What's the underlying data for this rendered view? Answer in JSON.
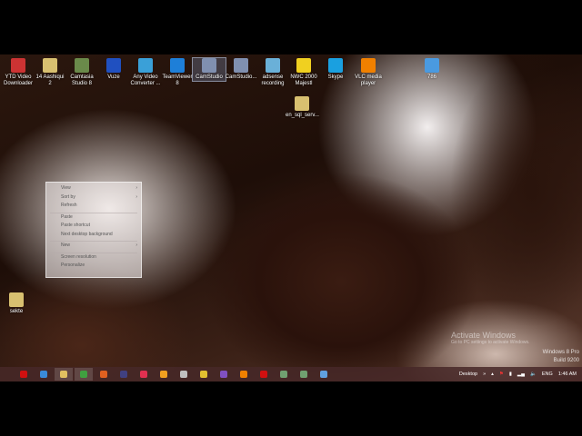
{
  "desktop_icons": [
    {
      "label": "YTD Video Downloader",
      "icon": "ytd-icon",
      "color": "#c33"
    },
    {
      "label": "14 Aashiqui 2",
      "icon": "folder-icon",
      "color": "#d8c070"
    },
    {
      "label": "Camtasia Studio 8",
      "icon": "camtasia-icon",
      "color": "#6a8a4a"
    },
    {
      "label": "Vuze",
      "icon": "vuze-icon",
      "color": "#2050c0"
    },
    {
      "label": "Any Video Converter ...",
      "icon": "converter-icon",
      "color": "#3aa0d8"
    },
    {
      "label": "TeamViewer 8",
      "icon": "teamviewer-icon",
      "color": "#1e7fd8"
    },
    {
      "label": "CamStudio",
      "icon": "camstudio-icon",
      "color": "#8090b0"
    },
    {
      "label": "CamStudio...",
      "icon": "camstudio-icon",
      "color": "#8090b0"
    },
    {
      "label": "adsense recording",
      "icon": "recording-icon",
      "color": "#6ab0d8"
    },
    {
      "label": "NWC 2000 Majestl",
      "icon": "star-icon",
      "color": "#f0d020"
    },
    {
      "label": "Skype",
      "icon": "skype-icon",
      "color": "#1aa0e0"
    },
    {
      "label": "VLC media player",
      "icon": "vlc-icon",
      "color": "#f08000"
    },
    {
      "label": "786",
      "icon": "file-icon",
      "color": "#4a9ae0"
    },
    {
      "label": "en_sql_serv...",
      "icon": "folder-icon",
      "color": "#d8c070"
    },
    {
      "label": "sekte",
      "icon": "folder-icon",
      "color": "#d8c070"
    }
  ],
  "context_menu": {
    "items": [
      "View",
      "Sort by",
      "Refresh",
      "Paste",
      "Paste shortcut",
      "Next desktop background",
      "New",
      "Screen resolution",
      "Personalize"
    ]
  },
  "watermark": {
    "title": "Activate Windows",
    "subtitle": "Go to PC settings to activate Windows."
  },
  "os_info": {
    "edition": "Windows 8 Pro",
    "build": "Build 9200"
  },
  "taskbar": {
    "apps": [
      {
        "name": "opera",
        "color": "#d01010"
      },
      {
        "name": "internet-explorer",
        "color": "#3a8ad8"
      },
      {
        "name": "file-explorer",
        "color": "#e0c060",
        "active": true
      },
      {
        "name": "chrome",
        "color": "#40a040",
        "active": true
      },
      {
        "name": "firefox",
        "color": "#e06020"
      },
      {
        "name": "media",
        "color": "#404080"
      },
      {
        "name": "app-red",
        "color": "#e03050"
      },
      {
        "name": "app-orange",
        "color": "#f0a020"
      },
      {
        "name": "app-gray",
        "color": "#c0c0c0"
      },
      {
        "name": "app-yellow",
        "color": "#e0c030"
      },
      {
        "name": "visual-studio",
        "color": "#8050c0"
      },
      {
        "name": "vlc",
        "color": "#f08000"
      },
      {
        "name": "acrobat",
        "color": "#d01010"
      },
      {
        "name": "camtasia",
        "color": "#70a070"
      },
      {
        "name": "camtasia-2",
        "color": "#70a070"
      },
      {
        "name": "network-app",
        "color": "#60a0e0"
      }
    ],
    "toolbar_label": "Desktop",
    "chevron": "»",
    "language": "ENG",
    "time": "1:46 AM"
  }
}
